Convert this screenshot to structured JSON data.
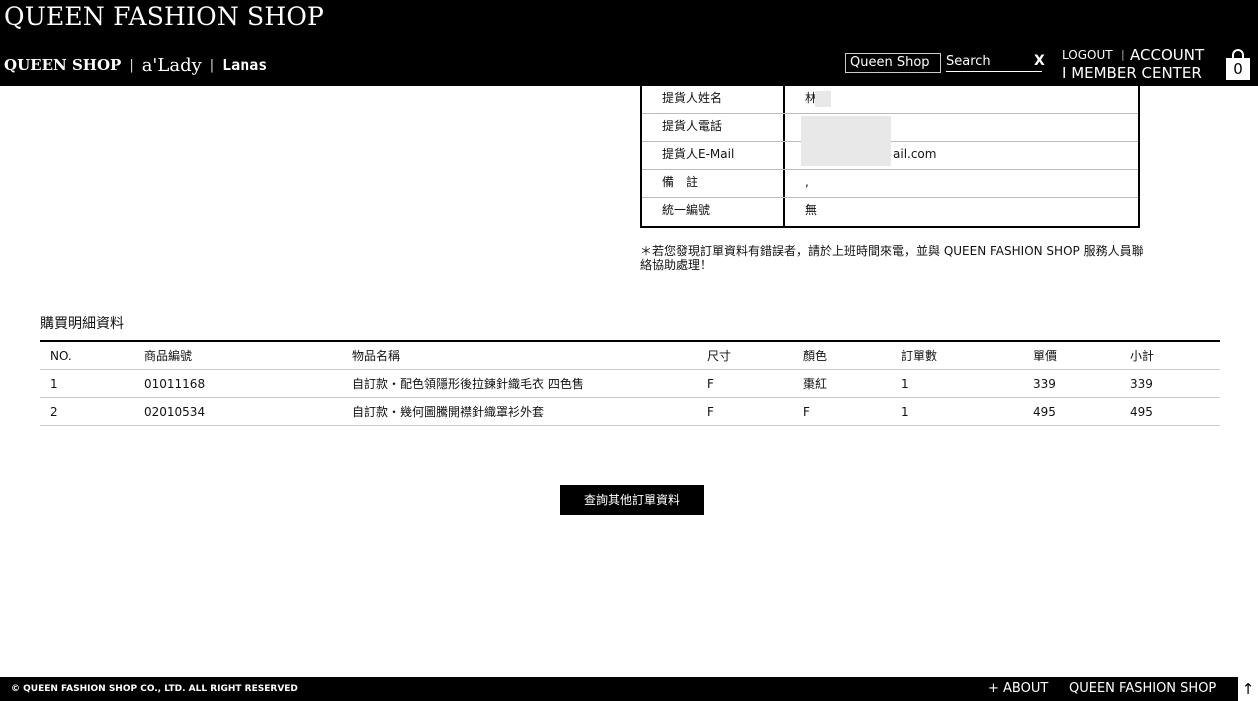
{
  "header": {
    "site_title": "QUEEN FASHION SHOP",
    "brands": [
      "QUEEN SHOP",
      "a'Lady",
      "Lanas"
    ],
    "brand_sep": "|",
    "store_select": "Queen Shop",
    "search_placeholder": "Search",
    "search_close": "X",
    "logout": "LOGOUT",
    "account": "ACCOUNT",
    "member_center": "I MEMBER CENTER",
    "cart_count": "0"
  },
  "order_info": {
    "rows": [
      {
        "label": "提貨人姓名",
        "value": "林"
      },
      {
        "label": "提貨人電話",
        "value": ""
      },
      {
        "label": "提貨人E-Mail",
        "value": "ail.com"
      },
      {
        "label": "備　註",
        "value": ","
      },
      {
        "label": "統一編號",
        "value": "無"
      }
    ]
  },
  "note": "＊若您發現訂單資料有錯誤者，請於上班時間來電，並與 QUEEN FASHION SHOP 服務人員聯絡協助處理！",
  "details": {
    "title": "購買明細資料",
    "columns": [
      "NO.",
      "商品編號",
      "物品名稱",
      "尺寸",
      "顏色",
      "訂單數",
      "單價",
      "小計"
    ],
    "rows": [
      [
        "1",
        "01011168",
        "自訂款・配色領隱形後拉鍊針織毛衣 四色售",
        "F",
        "棗紅",
        "1",
        "339",
        "339"
      ],
      [
        "2",
        "02010534",
        "自訂款・幾何圖騰開襟針織罩衫外套",
        "F",
        "F",
        "1",
        "495",
        "495"
      ]
    ]
  },
  "query_button": "查詢其他訂單資料",
  "footer": {
    "copyright": "© QUEEN FASHION SHOP CO., LTD. ALL RIGHT RESERVED",
    "about": "+ ABOUT",
    "brand": "QUEEN FASHION SHOP",
    "back_top": "↑"
  }
}
